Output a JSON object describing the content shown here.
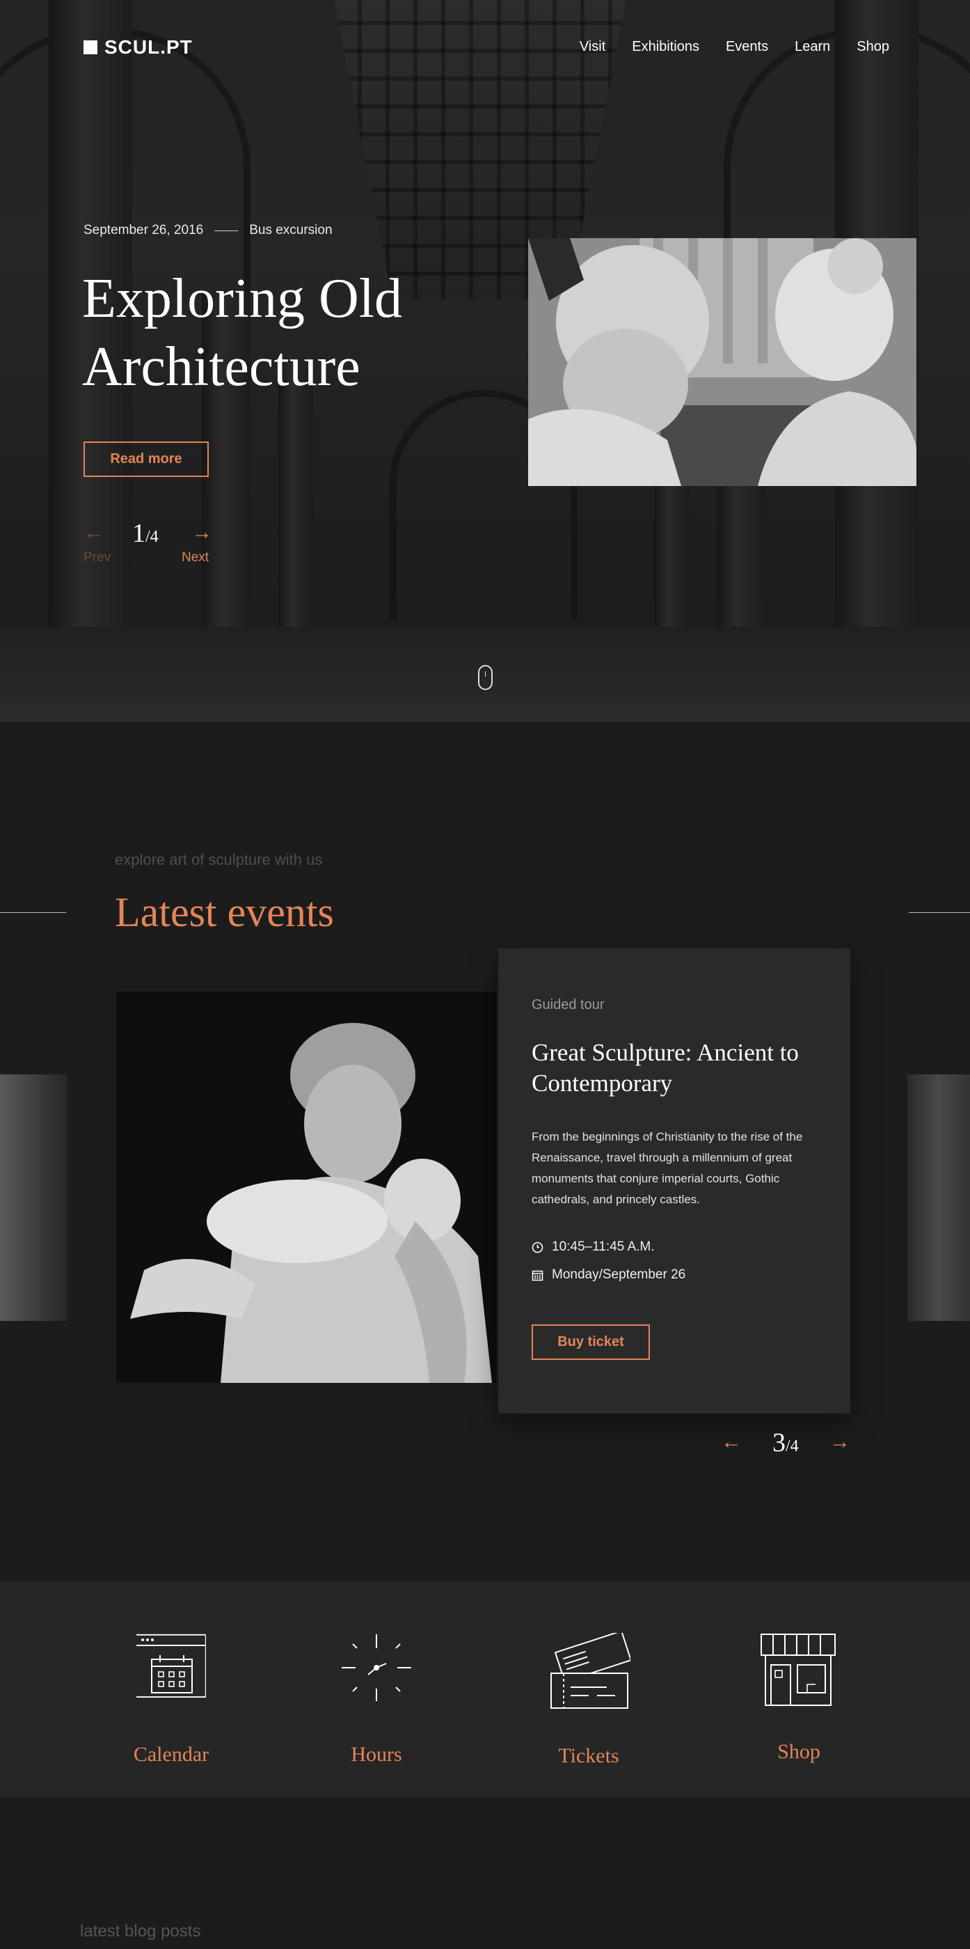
{
  "brand": {
    "name": "SCUL.PT"
  },
  "nav": [
    "Visit",
    "Exhibitions",
    "Events",
    "Learn",
    "Shop"
  ],
  "hero": {
    "date": "September 26, 2016",
    "category": "Bus excursion",
    "title": "Exploring Old Architecture",
    "cta": "Read more",
    "pager": {
      "current": "1",
      "total": "/4",
      "prev_label": "Prev",
      "next_label": "Next",
      "prev_arrow": "←",
      "next_arrow": "→"
    }
  },
  "events": {
    "kicker": "explore art of sculpture with us",
    "heading": "Latest events",
    "card": {
      "category": "Guided tour",
      "title": "Great Sculpture: Ancient to Contemporary",
      "description": "From the beginnings of Christianity to the rise of the Renaissance, travel through a millennium of great monuments that conjure imperial courts, Gothic cathedrals, and princely castles.",
      "time": "10:45–11:45 A.M.",
      "date": "Monday/September 26",
      "cta": "Buy ticket"
    },
    "pager": {
      "current": "3",
      "total": "/4",
      "prev_arrow": "←",
      "next_arrow": "→"
    }
  },
  "features": [
    {
      "label": "Calendar",
      "icon": "calendar-icon"
    },
    {
      "label": "Hours",
      "icon": "clock-icon"
    },
    {
      "label": "Tickets",
      "icon": "tickets-icon"
    },
    {
      "label": "Shop",
      "icon": "shop-icon"
    }
  ],
  "blog": {
    "kicker": "latest blog posts"
  },
  "colors": {
    "accent": "#e48556",
    "background": "#1c1c1c",
    "card": "#2a2a2a"
  }
}
